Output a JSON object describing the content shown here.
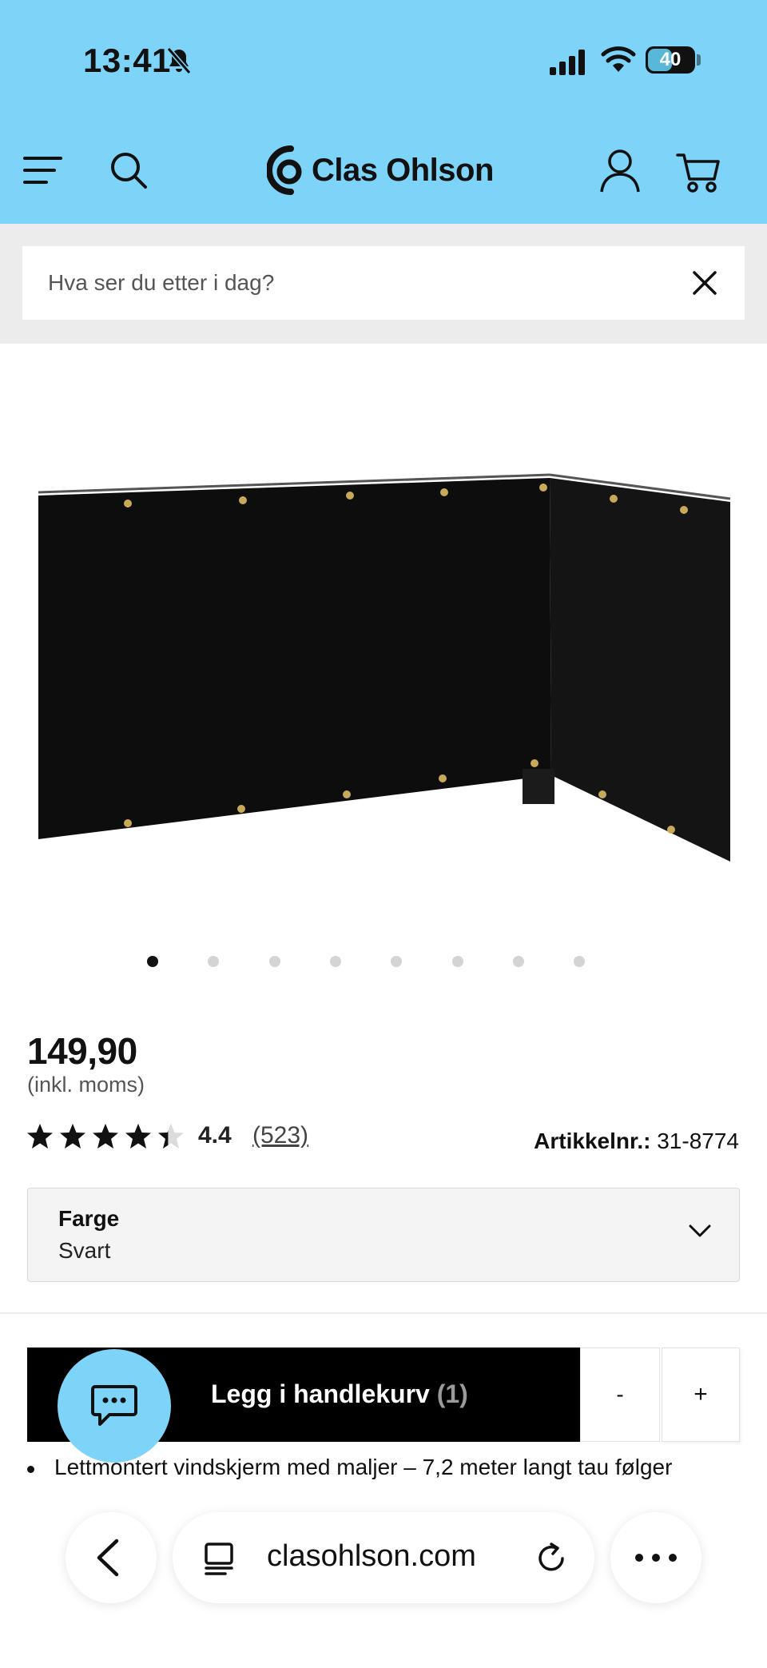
{
  "status_bar": {
    "time": "13:41",
    "battery": "40",
    "icons": [
      "bell-slash-icon",
      "signal-icon",
      "wifi-icon",
      "battery-icon"
    ]
  },
  "header": {
    "brand": "Clas Ohlson",
    "background": "#7dd3f8",
    "icons": [
      "menu-icon",
      "search-icon",
      "account-icon",
      "cart-icon"
    ]
  },
  "search": {
    "placeholder": "Hva ser du etter i dag?"
  },
  "gallery": {
    "image_count": 8,
    "active_index": 0
  },
  "product": {
    "price": "149,90",
    "vat_note": "(inkl. moms)",
    "rating": "4.4",
    "rating_value": 4.4,
    "reviews": "(523)",
    "article_label": "Artikkelnr.:",
    "article_number": "31-8774"
  },
  "color_select": {
    "label": "Farge",
    "value": "Svart"
  },
  "cart": {
    "add_label": "Legg i handlekurv",
    "count": "(1)",
    "minus": "-",
    "plus": "+"
  },
  "description": {
    "bullet": "Lettmontert vindskjerm med maljer – 7,2 meter langt tau følger"
  },
  "browser": {
    "url": "clasohlson.com"
  }
}
